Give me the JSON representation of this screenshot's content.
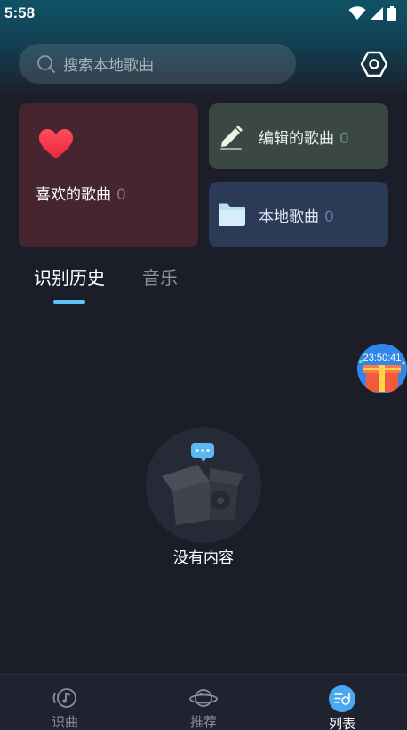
{
  "status": {
    "time": "5:58"
  },
  "search": {
    "placeholder": "搜索本地歌曲"
  },
  "cards": {
    "liked": {
      "label": "喜欢的歌曲",
      "count": "0"
    },
    "edited": {
      "label": "编辑的歌曲",
      "count": "0"
    },
    "local": {
      "label": "本地歌曲",
      "count": "0"
    }
  },
  "tabs": [
    {
      "label": "识别历史",
      "active": true
    },
    {
      "label": "音乐",
      "active": false
    }
  ],
  "float_widget": {
    "timer": "23:50:41"
  },
  "empty_state": {
    "text": "没有内容"
  },
  "bottom_nav": [
    {
      "label": "识曲",
      "icon": "music-recognize-icon",
      "active": false
    },
    {
      "label": "推荐",
      "icon": "planet-icon",
      "active": false
    },
    {
      "label": "列表",
      "icon": "list-icon",
      "active": true
    }
  ],
  "colors": {
    "accent": "#5ec4f5",
    "liked_card": "#462530",
    "edited_card": "#3a4745",
    "local_card": "#2b3a56",
    "background": "#1b1e29"
  }
}
